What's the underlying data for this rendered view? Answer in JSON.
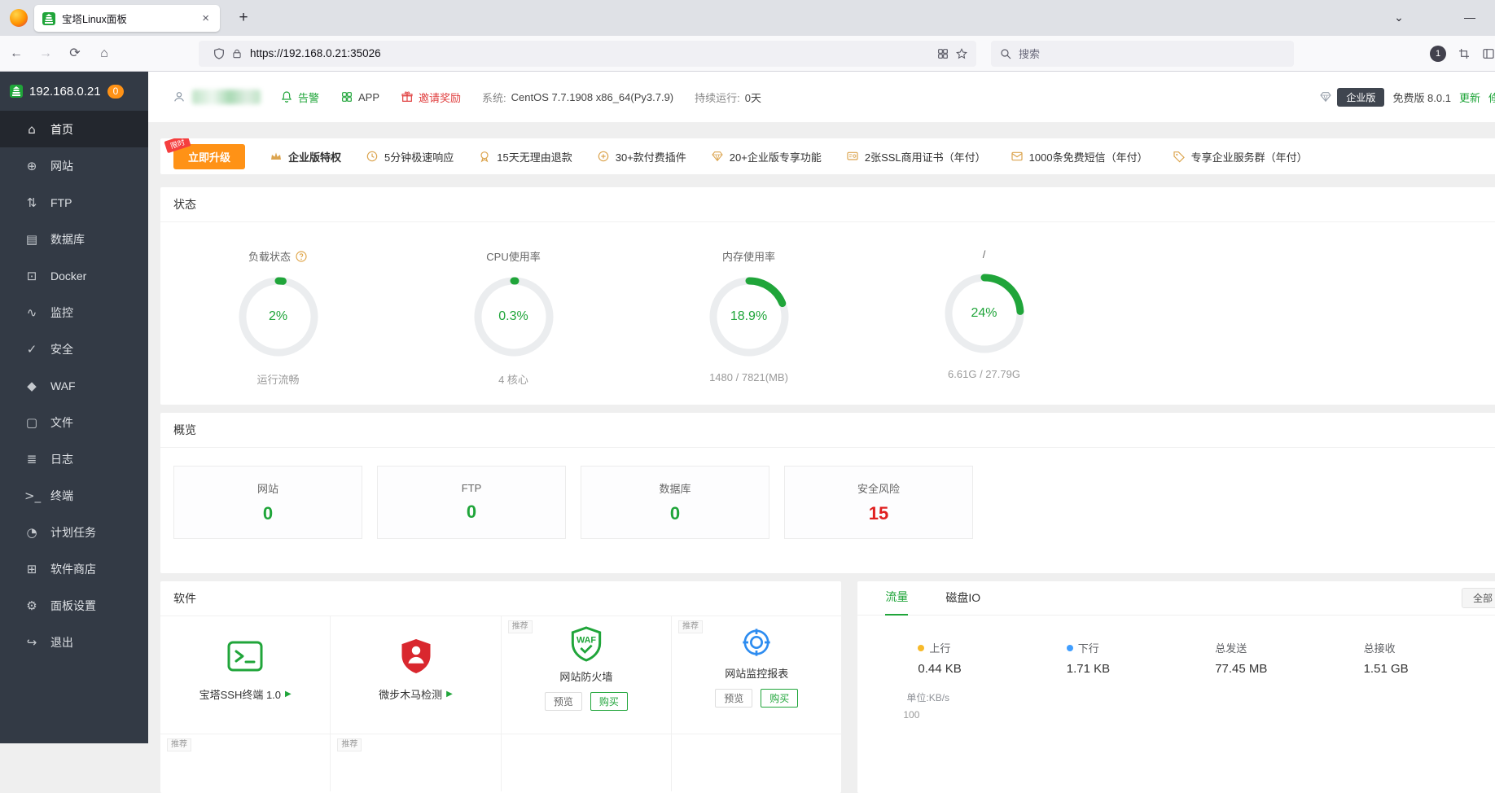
{
  "browser": {
    "tab_title": "宝塔Linux面板",
    "tab_close": "×",
    "new_tab": "+",
    "list_tabs": "⌄",
    "minimize": "—",
    "back": "←",
    "forward": "→",
    "reload": "⟳",
    "home": "⌂",
    "url": "https://192.168.0.21:35026",
    "search_placeholder": "搜索",
    "account_badge": "1"
  },
  "sidebar": {
    "server_ip": "192.168.0.21",
    "alert_count": "0",
    "items": [
      {
        "label": "首页",
        "icon": "home",
        "glyph": "⌂",
        "active": true
      },
      {
        "label": "网站",
        "icon": "website-globe",
        "glyph": "⊕"
      },
      {
        "label": "FTP",
        "icon": "ftp-transfer",
        "glyph": "⇅"
      },
      {
        "label": "数据库",
        "icon": "database",
        "glyph": "▤"
      },
      {
        "label": "Docker",
        "icon": "docker",
        "glyph": "⊡"
      },
      {
        "label": "监控",
        "icon": "monitor-wave",
        "glyph": "∿"
      },
      {
        "label": "安全",
        "icon": "shield-check",
        "glyph": "✓"
      },
      {
        "label": "WAF",
        "icon": "waf-shield",
        "glyph": "◆"
      },
      {
        "label": "文件",
        "icon": "folder",
        "glyph": "▢"
      },
      {
        "label": "日志",
        "icon": "log-lines",
        "glyph": "≣"
      },
      {
        "label": "终端",
        "icon": "terminal-prompt",
        "glyph": ">_"
      },
      {
        "label": "计划任务",
        "icon": "schedule-clock",
        "glyph": "◔"
      },
      {
        "label": "软件商店",
        "icon": "app-store-grid",
        "glyph": "⊞"
      },
      {
        "label": "面板设置",
        "icon": "gear",
        "glyph": "⚙"
      },
      {
        "label": "退出",
        "icon": "logout-arrow",
        "glyph": "↪"
      }
    ]
  },
  "topbar": {
    "alarm": "告警",
    "app": "APP",
    "invite": "邀请奖励",
    "system_label": "系统:",
    "system_value": "CentOS 7.7.1908 x86_64(Py3.7.9)",
    "uptime_label": "持续运行:",
    "uptime_value": "0天",
    "enterprise_badge": "企业版",
    "version": "免费版 8.0.1",
    "update": "更新",
    "repair": "修复"
  },
  "promo": {
    "ribbon": "限时",
    "upgrade_button": "立即升级",
    "items": [
      {
        "label": "企业版特权",
        "icon": "crown"
      },
      {
        "label": "5分钟极速响应",
        "icon": "clock"
      },
      {
        "label": "15天无理由退款",
        "icon": "medal"
      },
      {
        "label": "30+款付费插件",
        "icon": "plugin"
      },
      {
        "label": "20+企业版专享功能",
        "icon": "gem"
      },
      {
        "label": "2张SSL商用证书（年付）",
        "icon": "certificate"
      },
      {
        "label": "1000条免费短信（年付）",
        "icon": "mail"
      },
      {
        "label": "专享企业服务群（年付）",
        "icon": "tag"
      }
    ]
  },
  "status": {
    "title": "状态",
    "gauges": [
      {
        "label": "负载状态",
        "percent": 2,
        "value": "2%",
        "sub": "运行流畅",
        "help": true
      },
      {
        "label": "CPU使用率",
        "percent": 0.3,
        "value": "0.3%",
        "sub": "4 核心"
      },
      {
        "label": "内存使用率",
        "percent": 18.9,
        "value": "18.9%",
        "sub": "1480 / 7821(MB)"
      },
      {
        "label": "/",
        "percent": 24,
        "value": "24%",
        "sub": "6.61G / 27.79G"
      }
    ]
  },
  "overview": {
    "title": "概览",
    "cards": [
      {
        "label": "网站",
        "value": "0"
      },
      {
        "label": "FTP",
        "value": "0"
      },
      {
        "label": "数据库",
        "value": "0"
      },
      {
        "label": "安全风险",
        "value": "15"
      }
    ]
  },
  "software": {
    "title": "软件",
    "recommend_tag": "推荐",
    "items": [
      {
        "name": "宝塔SSH终端 1.0"
      },
      {
        "name": "微步木马检测"
      },
      {
        "name": "网站防火墙",
        "icon_text": "WAF",
        "preview": "预览",
        "buy": "购买"
      },
      {
        "name": "网站监控报表",
        "preview": "预览",
        "buy": "购买"
      }
    ]
  },
  "traffic": {
    "tab_traffic": "流量",
    "tab_diskio": "磁盘IO",
    "all_button": "全部",
    "stats": [
      {
        "label": "上行",
        "value": "0.44 KB"
      },
      {
        "label": "下行",
        "value": "1.71 KB"
      },
      {
        "label": "总发送",
        "value": "77.45 MB"
      },
      {
        "label": "总接收",
        "value": "1.51 GB"
      }
    ],
    "unit": "单位:KB/s",
    "ytick": "100"
  },
  "colors": {
    "green": "#20a53a",
    "red": "#e02020",
    "orange": "#ff9216"
  }
}
